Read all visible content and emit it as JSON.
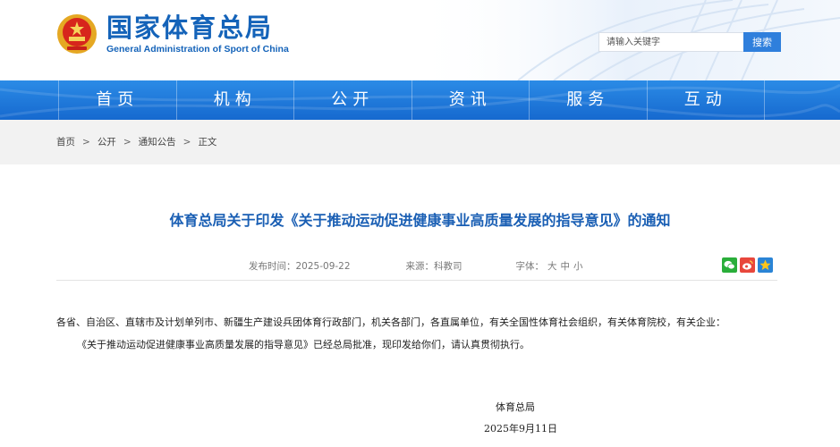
{
  "header": {
    "logo_cn": "国家体育总局",
    "logo_en": "General Administration of Sport of China"
  },
  "search": {
    "placeholder": "请输入关键字",
    "button_label": "搜索"
  },
  "nav": {
    "items": [
      {
        "label": "首页"
      },
      {
        "label": "机构"
      },
      {
        "label": "公开"
      },
      {
        "label": "资讯"
      },
      {
        "label": "服务"
      },
      {
        "label": "互动"
      }
    ]
  },
  "breadcrumb": {
    "items": [
      "首页",
      "公开",
      "通知公告",
      "正文"
    ],
    "separator": ">"
  },
  "article": {
    "title": "体育总局关于印发《关于推动运动促进健康事业高质量发展的指导意见》的通知",
    "publish_time": "发布时间：2025-09-22",
    "source": "来源：科教司",
    "font_size_label": "字体：",
    "font_sizes": [
      "大",
      "中",
      "小"
    ],
    "paragraphs": [
      "各省、自治区、直辖市及计划单列市、新疆生产建设兵团体育行政部门，机关各部门，各直属单位，有关全国性体育社会组织，有关体育院校，有关企业：",
      "《关于推动运动促进健康事业高质量发展的指导意见》已经总局批准，现印发给你们，请认真贯彻执行。"
    ],
    "signature": "体育总局",
    "sign_date": "2025年9月11日"
  },
  "share": {
    "icons": [
      "wechat-icon",
      "weibo-icon",
      "qzone-icon"
    ]
  },
  "colors": {
    "brand_blue": "#1463b9",
    "nav_blue": "#1f78dc",
    "title_blue": "#1a5fb4",
    "search_button": "#2f7fdc",
    "wechat_green": "#2aae3a",
    "weibo_red": "#e8473c",
    "qzone_blue": "#2a84d6"
  }
}
